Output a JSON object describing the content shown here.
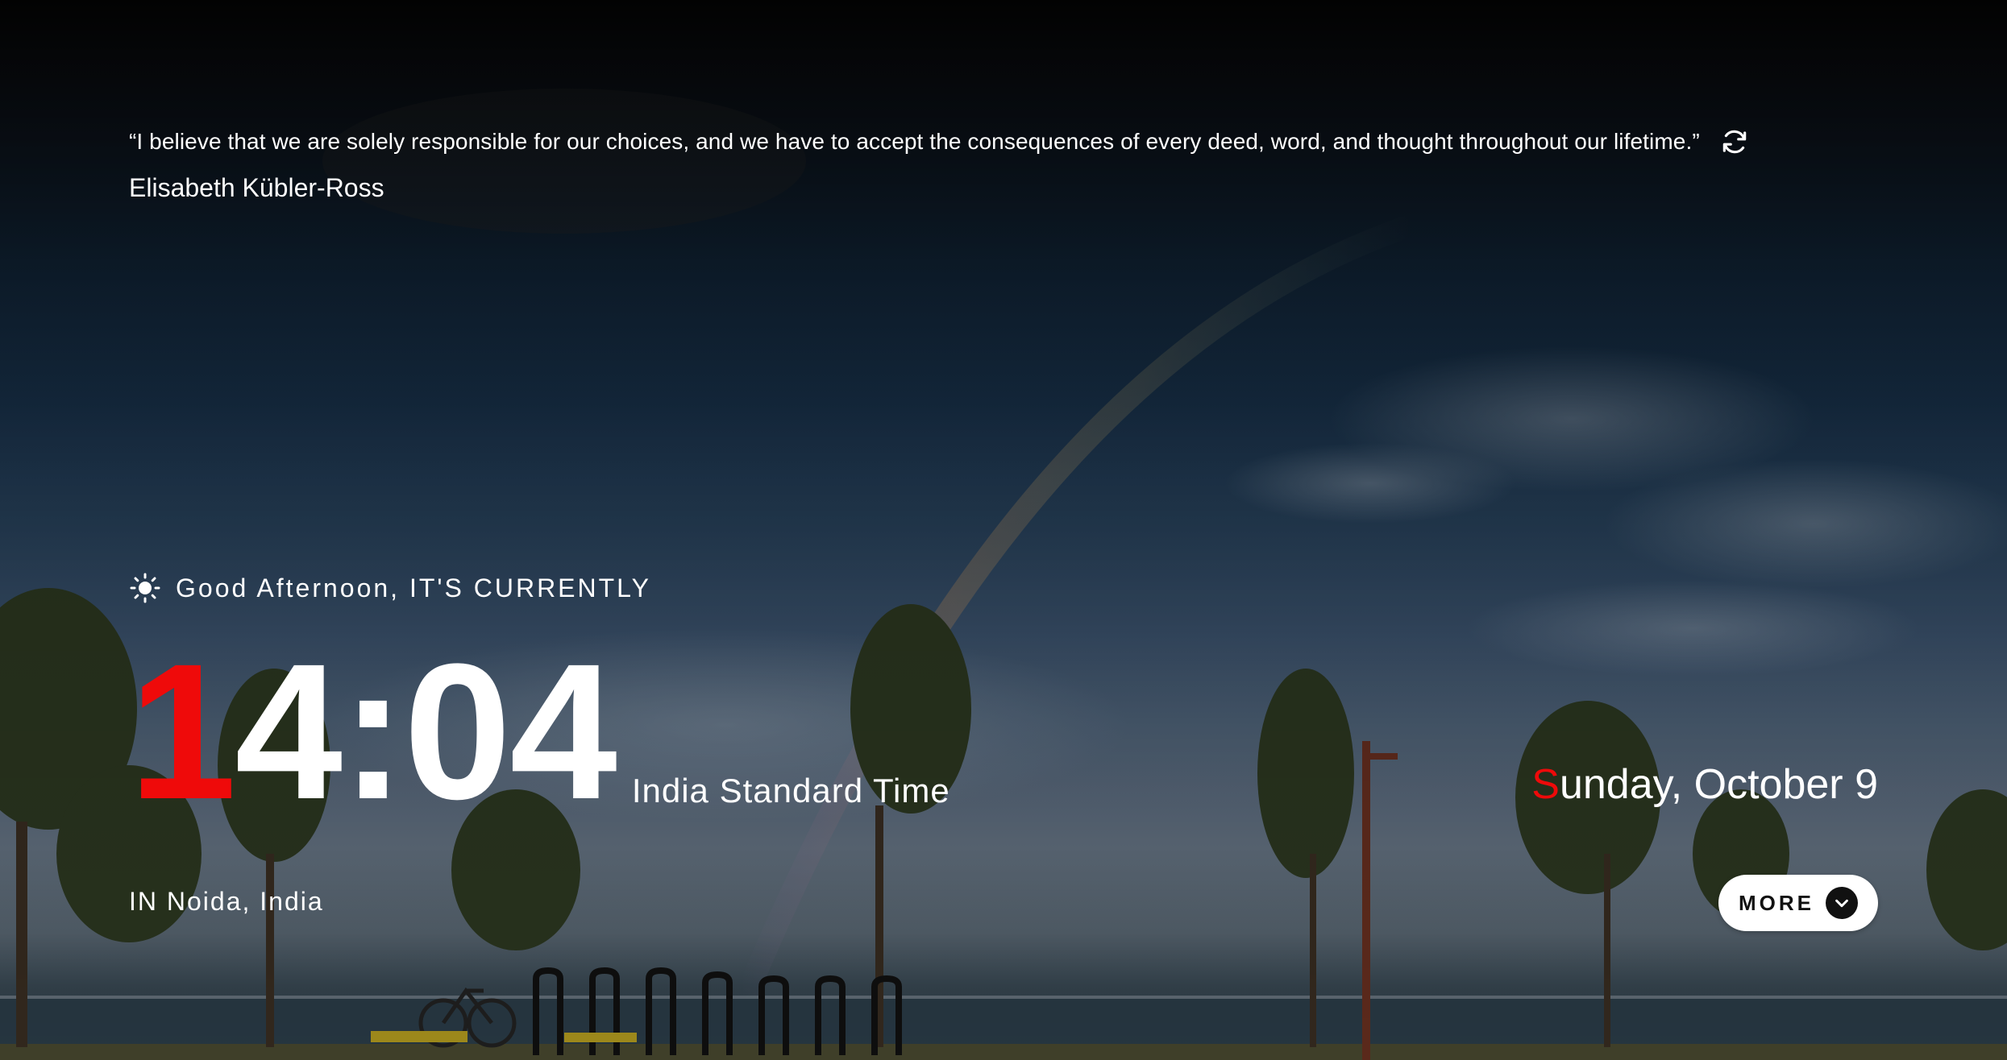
{
  "quote": {
    "text": "“I believe that we are solely responsible for our choices, and we have to accept the consequences of every deed, word, and thought throughout our lifetime.”",
    "author": "Elisabeth Kübler-Ross",
    "refresh_icon": "refresh-icon"
  },
  "greeting": {
    "icon": "sun-icon",
    "text": "Good Afternoon, IT'S CURRENTLY"
  },
  "clock": {
    "time_first": "1",
    "time_rest": "4:04",
    "timezone": "India Standard Time"
  },
  "date": {
    "first_letter": "S",
    "rest": "unday, October 9"
  },
  "location": {
    "text": "IN Noida, India"
  },
  "more_button": {
    "label": "MORE",
    "icon": "chevron-down-icon"
  },
  "colors": {
    "accent": "#ef0a0a",
    "text": "#ffffff",
    "button_bg": "#ffffff",
    "button_text": "#111111"
  }
}
